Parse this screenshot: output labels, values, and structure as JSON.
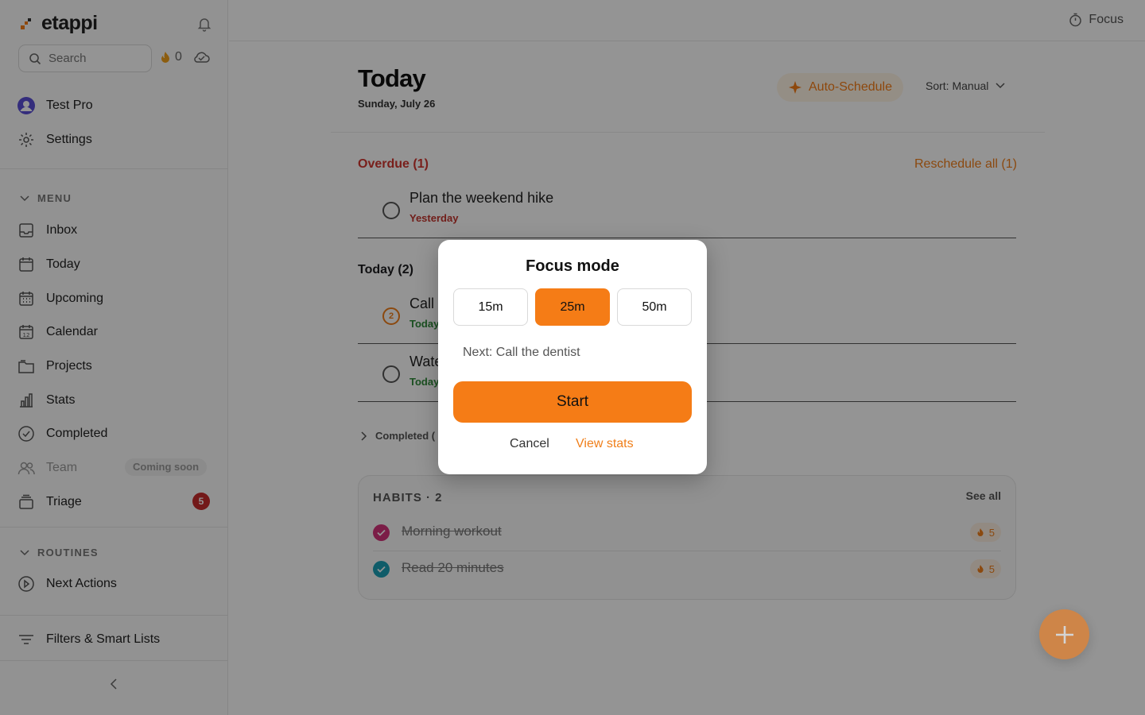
{
  "app": {
    "name": "etappi"
  },
  "sidebar": {
    "search_placeholder": "Search",
    "streak_count": "0",
    "user_name": "Test Pro",
    "settings_label": "Settings",
    "menu_title": "MENU",
    "menu_items": [
      {
        "label": "Inbox",
        "icon": "inbox-icon"
      },
      {
        "label": "Today",
        "icon": "calendar-today-icon"
      },
      {
        "label": "Upcoming",
        "icon": "calendar-grid-icon"
      },
      {
        "label": "Calendar",
        "icon": "calendar-12-icon"
      },
      {
        "label": "Projects",
        "icon": "folder-icon"
      },
      {
        "label": "Stats",
        "icon": "bar-chart-icon"
      },
      {
        "label": "Completed",
        "icon": "check-circle-icon"
      },
      {
        "label": "Team",
        "icon": "team-icon"
      },
      {
        "label": "Triage",
        "icon": "tray-stack-icon"
      }
    ],
    "team_badge": "Coming soon",
    "triage_count": "5",
    "routines_title": "ROUTINES",
    "routine_items": [
      {
        "label": "Next Actions",
        "icon": "play-circle-icon"
      }
    ],
    "filters_label": "Filters & Smart Lists"
  },
  "topbar": {
    "focus_label": "Focus"
  },
  "main": {
    "title": "Today",
    "date": "Sunday, July 26",
    "auto_schedule": "Auto-Schedule",
    "sort_label": "Sort: Manual",
    "overdue_title": "Overdue (1)",
    "reschedule_label": "Reschedule all (1)",
    "overdue_tasks": [
      {
        "title": "Plan the weekend hike",
        "due": "Yesterday"
      }
    ],
    "today_title": "Today (2)",
    "today_tasks": [
      {
        "title": "Call",
        "due": "Today",
        "priority": "2"
      },
      {
        "title": "Wate",
        "due": "Today"
      }
    ],
    "completed_label": "Completed (",
    "habits": {
      "title": "HABITS · 2",
      "see_all": "See all",
      "items": [
        {
          "name": "Morning workout",
          "streak": "5",
          "color": "#d4337a"
        },
        {
          "name": "Read 20 minutes",
          "streak": "5",
          "color": "#1a9fb5"
        }
      ]
    }
  },
  "modal": {
    "title": "Focus mode",
    "durations": [
      "15m",
      "25m",
      "50m"
    ],
    "selected_duration": "25m",
    "next_task": "Next: Call the dentist",
    "start_label": "Start",
    "cancel_label": "Cancel",
    "stats_label": "View stats"
  },
  "colors": {
    "accent": "#f57c16",
    "danger": "#d0362f",
    "success": "#2f8a3a"
  }
}
